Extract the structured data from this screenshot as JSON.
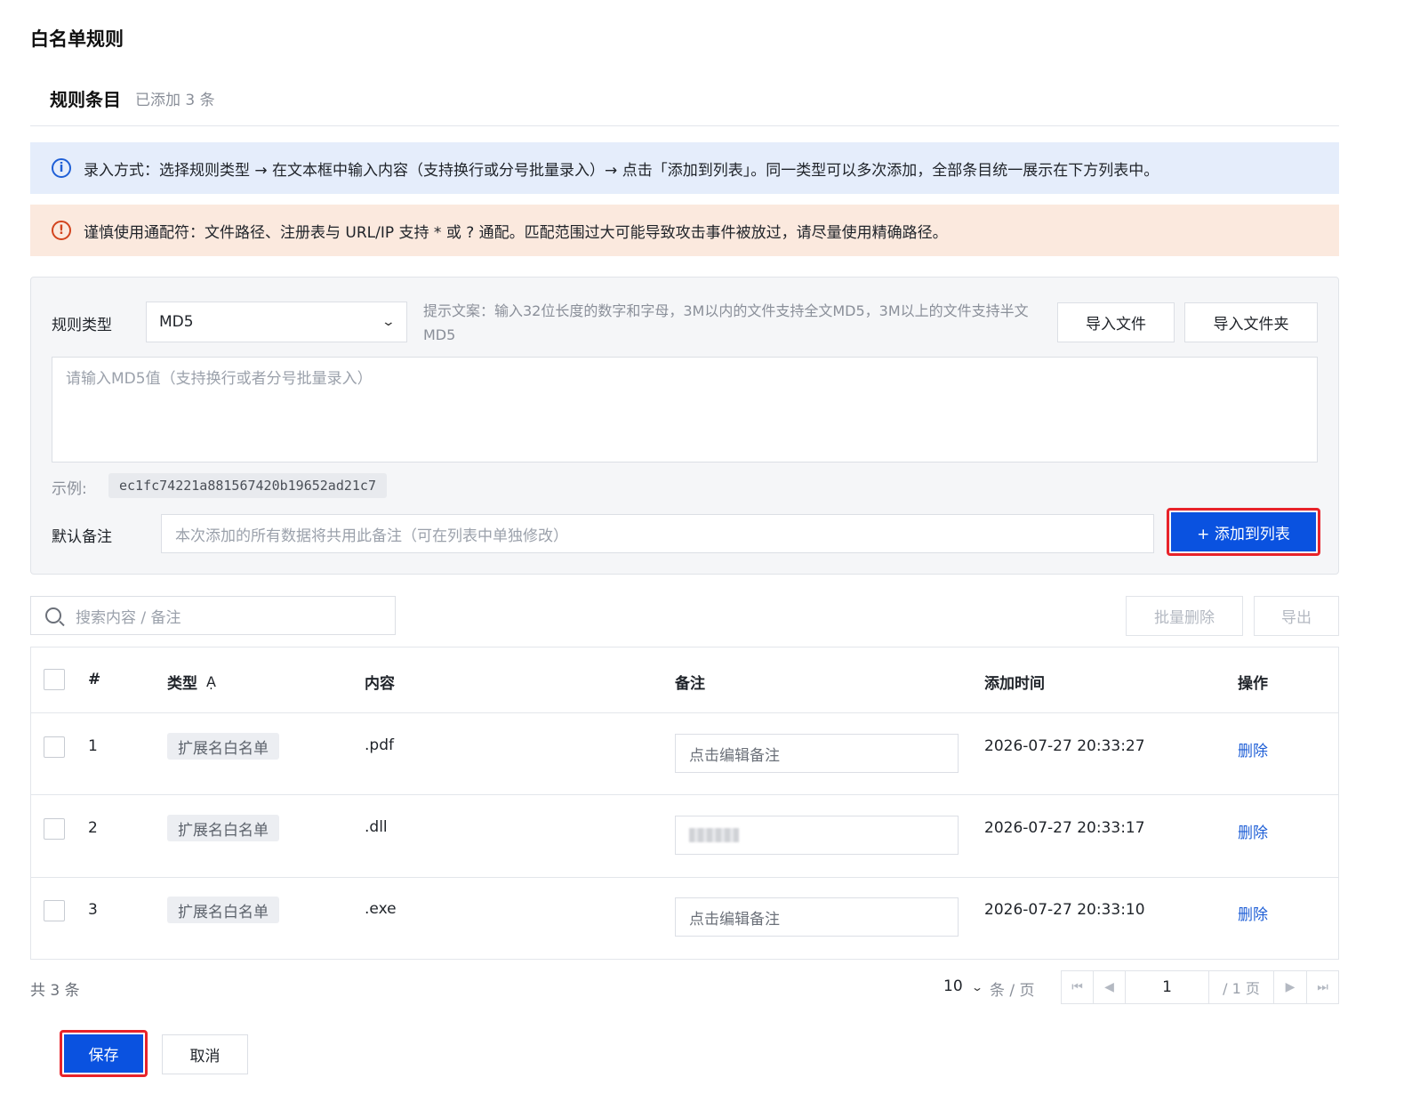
{
  "page": {
    "title": "白名单规则"
  },
  "section": {
    "title": "规则条目",
    "count": "已添加 3 条"
  },
  "alerts": {
    "info": {
      "icon": "info-circle-icon",
      "text": "录入方式：选择规则类型 → 在文本框中输入内容（支持换行或分号批量录入）→ 点击「添加到列表」。同一类型可以多次添加，全部条目统一展示在下方列表中。"
    },
    "warn": {
      "icon": "warning-circle-icon",
      "text": "谨慎使用通配符：文件路径、注册表与 URL/IP 支持 * 或 ? 通配。匹配范围过大可能导致攻击事件被放过，请尽量使用精确路径。"
    }
  },
  "form": {
    "type_label": "规则类型",
    "type_value": "MD5",
    "hint": "提示文案：输入32位长度的数字和字母，3M以内的文件支持全文MD5，3M以上的文件支持半文MD5",
    "import_file": "导入文件",
    "import_folder": "导入文件夹",
    "textarea_placeholder": "请输入MD5值（支持换行或者分号批量录入）",
    "example_label": "示例:",
    "example_value": "ec1fc74221a881567420b19652ad21c7",
    "note_label": "默认备注",
    "note_placeholder": "本次添加的所有数据将共用此备注（可在列表中单独修改）",
    "add_button": "+ 添加到列表"
  },
  "toolbar": {
    "search_placeholder": "搜索内容 / 备注",
    "batch_delete": "批量删除",
    "export": "导出"
  },
  "table": {
    "columns": [
      "#",
      "类型",
      "内容",
      "备注",
      "添加时间",
      "操作"
    ],
    "rows": [
      {
        "no": "1",
        "type": "扩展名白名单",
        "content": ".pdf",
        "remark": "点击编辑备注",
        "time": "2026-07-27 20:33:27",
        "action": "删除"
      },
      {
        "no": "2",
        "type": "扩展名白名单",
        "content": ".dll",
        "remark": "",
        "time": "2026-07-27 20:33:17",
        "action": "删除"
      },
      {
        "no": "3",
        "type": "扩展名白名单",
        "content": ".exe",
        "remark": "点击编辑备注",
        "time": "2026-07-27 20:33:10",
        "action": "删除"
      }
    ]
  },
  "pagination": {
    "total": "共 3 条",
    "page_size": "10",
    "unit": "条 / 页",
    "current": "1",
    "pages": "/ 1 页"
  },
  "footer": {
    "save": "保存",
    "cancel": "取消"
  },
  "colors": {
    "primary": "#0a52e0",
    "highlight": "#e8232a",
    "link": "#1f5fd6",
    "info_bg": "#e5edfb",
    "warn_bg": "#fbe9de"
  }
}
